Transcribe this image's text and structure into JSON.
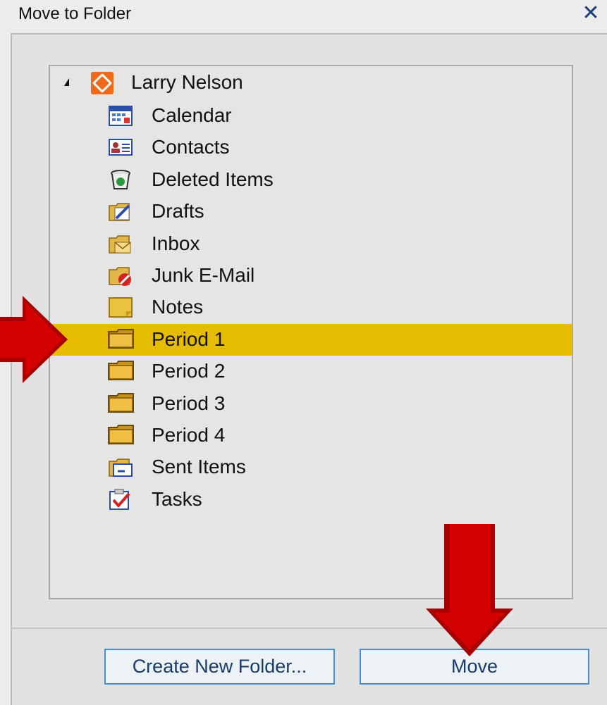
{
  "dialog": {
    "title": "Move to Folder",
    "close_glyph": "✕"
  },
  "tree": {
    "root": {
      "label": "Larry Nelson",
      "icon": "mailbox-icon",
      "expanded": true
    },
    "folders": [
      {
        "label": "Calendar",
        "icon": "calendar-icon",
        "selected": false
      },
      {
        "label": "Contacts",
        "icon": "contacts-icon",
        "selected": false
      },
      {
        "label": "Deleted Items",
        "icon": "deleted-items-icon",
        "selected": false
      },
      {
        "label": "Drafts",
        "icon": "drafts-icon",
        "selected": false
      },
      {
        "label": "Inbox",
        "icon": "inbox-icon",
        "selected": false
      },
      {
        "label": "Junk E-Mail",
        "icon": "junk-mail-icon",
        "selected": false
      },
      {
        "label": "Notes",
        "icon": "notes-icon",
        "selected": false
      },
      {
        "label": "Period 1",
        "icon": "folder-icon",
        "selected": true
      },
      {
        "label": "Period 2",
        "icon": "folder-icon",
        "selected": false
      },
      {
        "label": "Period 3",
        "icon": "folder-icon",
        "selected": false
      },
      {
        "label": "Period 4",
        "icon": "folder-icon",
        "selected": false
      },
      {
        "label": "Sent Items",
        "icon": "sent-items-icon",
        "selected": false
      },
      {
        "label": "Tasks",
        "icon": "tasks-icon",
        "selected": false
      }
    ]
  },
  "buttons": {
    "create_new_folder": "Create New Folder...",
    "move": "Move"
  },
  "colors": {
    "selection": "#e6bc00",
    "button_border": "#4a8bd6",
    "arrow_red": "#cc0000"
  }
}
